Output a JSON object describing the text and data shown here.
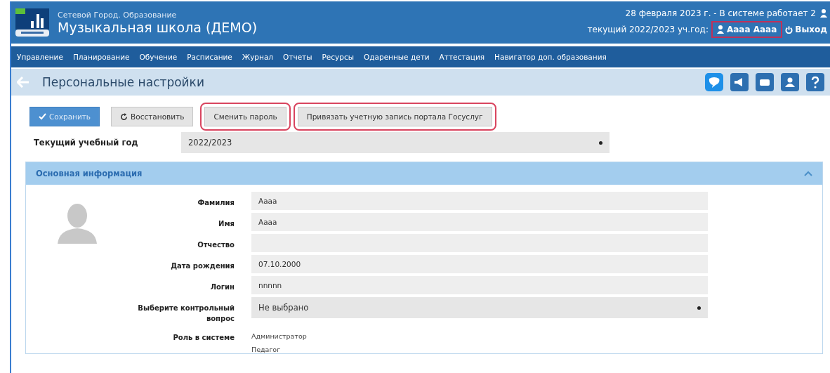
{
  "header": {
    "subtitle": "Сетевой Город. Образование",
    "title": "Музыкальная школа (ДЕМО)",
    "status": "28 февраля 2023 г. - В системе работает 2",
    "year": "текущий 2022/2023 уч.год:",
    "user": {
      "label": "Аааа Аааа",
      "highlighted": true
    },
    "logout": "Выход"
  },
  "nav": [
    "Управление",
    "Планирование",
    "Обучение",
    "Расписание",
    "Журнал",
    "Отчеты",
    "Ресурсы",
    "Одаренные дети",
    "Аттестация",
    "Навигатор доп. образования"
  ],
  "page_title": "Персональные настройки",
  "buttons": [
    {
      "kind": "primary",
      "label": "Сохранить",
      "highlighted": false
    },
    {
      "kind": "restore",
      "label": "Восстановить",
      "highlighted": false
    },
    {
      "kind": "plain",
      "label": "Сменить пароль",
      "highlighted": true
    },
    {
      "kind": "plain",
      "label": "Привязать учетную запись портала Госуслуг",
      "highlighted": true
    }
  ],
  "year_field": {
    "label": "Текущий учебный год",
    "value": "2022/2023"
  },
  "section": {
    "title": "Основная информация",
    "expanded": true
  },
  "fields": [
    {
      "kind": "text",
      "label": "Фамилия",
      "value": "Аааа"
    },
    {
      "kind": "text",
      "label": "Имя",
      "value": "Аааа"
    },
    {
      "kind": "text",
      "label": "Отчество"
    },
    {
      "kind": "text",
      "label": "Дата рождения",
      "value": "07.10.2000"
    },
    {
      "kind": "text",
      "label": "Логин",
      "value": "nnnnn"
    },
    {
      "kind": "select",
      "label": "Выберите контрольный вопрос",
      "value": "Не выбрано"
    }
  ],
  "roles": {
    "label": "Роль в системе",
    "items": [
      "Администратор",
      "Педагог"
    ]
  }
}
